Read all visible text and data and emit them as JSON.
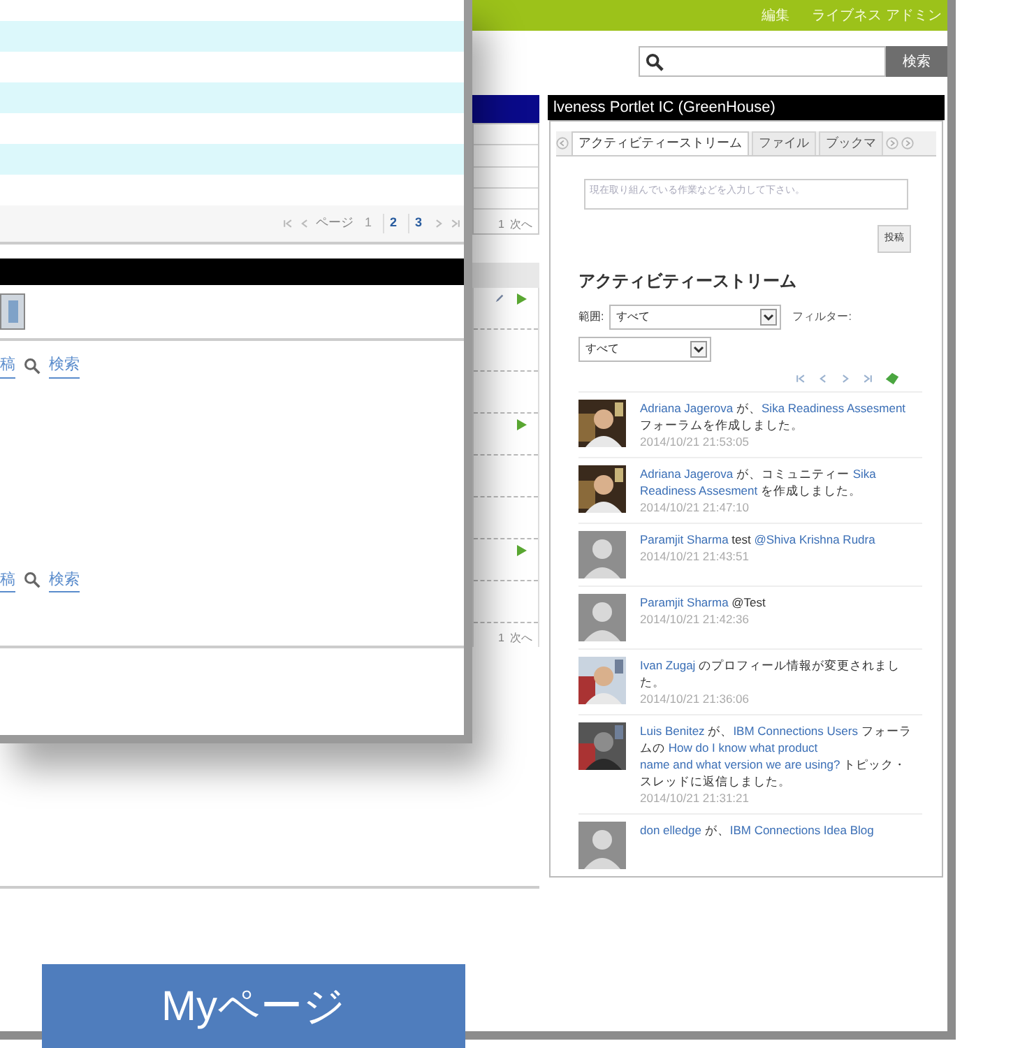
{
  "back_window": {
    "top_bar": {
      "links": [
        "編集",
        "ライブネス アドミン"
      ]
    },
    "search": {
      "button": "検索"
    },
    "side_column": {
      "top_list": {
        "pager": {
          "page": "1",
          "next": "次へ"
        }
      },
      "bottom_list": {
        "rows": [
          {
            "icons": [
              {
                "kind": "pencil"
              },
              {
                "kind": "play"
              }
            ]
          },
          {},
          {},
          {
            "icons": [
              {
                "kind": "play"
              }
            ]
          },
          {},
          {},
          {
            "icons": [
              {
                "kind": "play"
              }
            ]
          },
          {}
        ],
        "pager": {
          "page": "1",
          "next": "次へ"
        }
      }
    },
    "portlet": {
      "title": "lveness Portlet IC (GreenHouse)",
      "tabs": [
        {
          "label": "アクティビティーストリーム",
          "selected": true
        },
        {
          "label": "ファイル",
          "selected": false
        },
        {
          "label": "ブックマ",
          "selected": false
        }
      ],
      "status": {
        "placeholder": "現在取り組んでいる作業などを入力して下さい。",
        "button": "投稿"
      },
      "heading": "アクティビティーストリーム",
      "scope": {
        "label": "範囲:",
        "value": "すべて"
      },
      "filter": {
        "label": "フィルター:",
        "value": "すべて"
      },
      "entries": [
        {
          "parts": [
            {
              "kind": "link",
              "text": "Adriana Jagerova"
            },
            {
              "kind": "text",
              "text": " が、"
            },
            {
              "kind": "link",
              "text": "Sika Readiness"
            },
            {
              "kind": "link",
              "text": "Assesment"
            },
            {
              "kind": "text",
              "text": " フォーラムを作成しました。"
            }
          ],
          "time": "2014/10/21 21:53:05"
        },
        {
          "parts": [
            {
              "kind": "link",
              "text": "Adriana Jagerova"
            },
            {
              "kind": "text",
              "text": " が、コミュニティー "
            },
            {
              "kind": "link",
              "text": "Sika"
            },
            {
              "kind": "link",
              "text": "Readiness Assesment"
            },
            {
              "kind": "text",
              "text": " を作成しました。"
            }
          ],
          "time": "2014/10/21 21:47:10"
        },
        {
          "kind": "silhouette",
          "parts": [
            {
              "kind": "link",
              "text": "Paramjit Sharma"
            },
            {
              "kind": "text",
              "text": " test "
            },
            {
              "kind": "link",
              "text": "@Shiva Krishna Rudra"
            }
          ],
          "time": "2014/10/21 21:43:51"
        },
        {
          "kind": "silhouette",
          "parts": [
            {
              "kind": "link",
              "text": "Paramjit Sharma"
            },
            {
              "kind": "text",
              "text": " @Test"
            }
          ],
          "time": "2014/10/21 21:42:36"
        },
        {
          "parts": [
            {
              "kind": "link",
              "text": "Ivan Zugaj"
            },
            {
              "kind": "text",
              "text": " のプロフィール情報が変更されました。"
            }
          ],
          "time": "2014/10/21 21:36:06"
        },
        {
          "parts": [
            {
              "kind": "link",
              "text": "Luis Benitez"
            },
            {
              "kind": "text",
              "text": " が、"
            },
            {
              "kind": "link",
              "text": "IBM Connections Users"
            },
            {
              "kind": "text",
              "text": " フォーラムの "
            },
            {
              "kind": "link",
              "text": "How do I know what product"
            },
            {
              "kind": "link",
              "text": "name and what version we are using?"
            },
            {
              "kind": "text",
              "text": " トピック・スレッドに返信しました。"
            }
          ],
          "time": "2014/10/21 21:31:21"
        },
        {
          "kind": "silhouette",
          "parts": [
            {
              "kind": "link",
              "text": "don elledge"
            },
            {
              "kind": "text",
              "text": " が、"
            },
            {
              "kind": "link",
              "text": "IBM Connections Idea Blog"
            }
          ]
        }
      ]
    }
  },
  "front_window": {
    "pager": {
      "label": "ページ",
      "pages": [
        {
          "label": "1",
          "selected": true
        },
        {
          "label": "2",
          "selected": false
        },
        {
          "label": "3",
          "selected": false
        }
      ]
    },
    "link_rows": [
      {
        "links": [
          "稿",
          "検索"
        ]
      },
      {
        "links": [
          "稿",
          "検索"
        ]
      }
    ]
  },
  "caption": "Myページ"
}
